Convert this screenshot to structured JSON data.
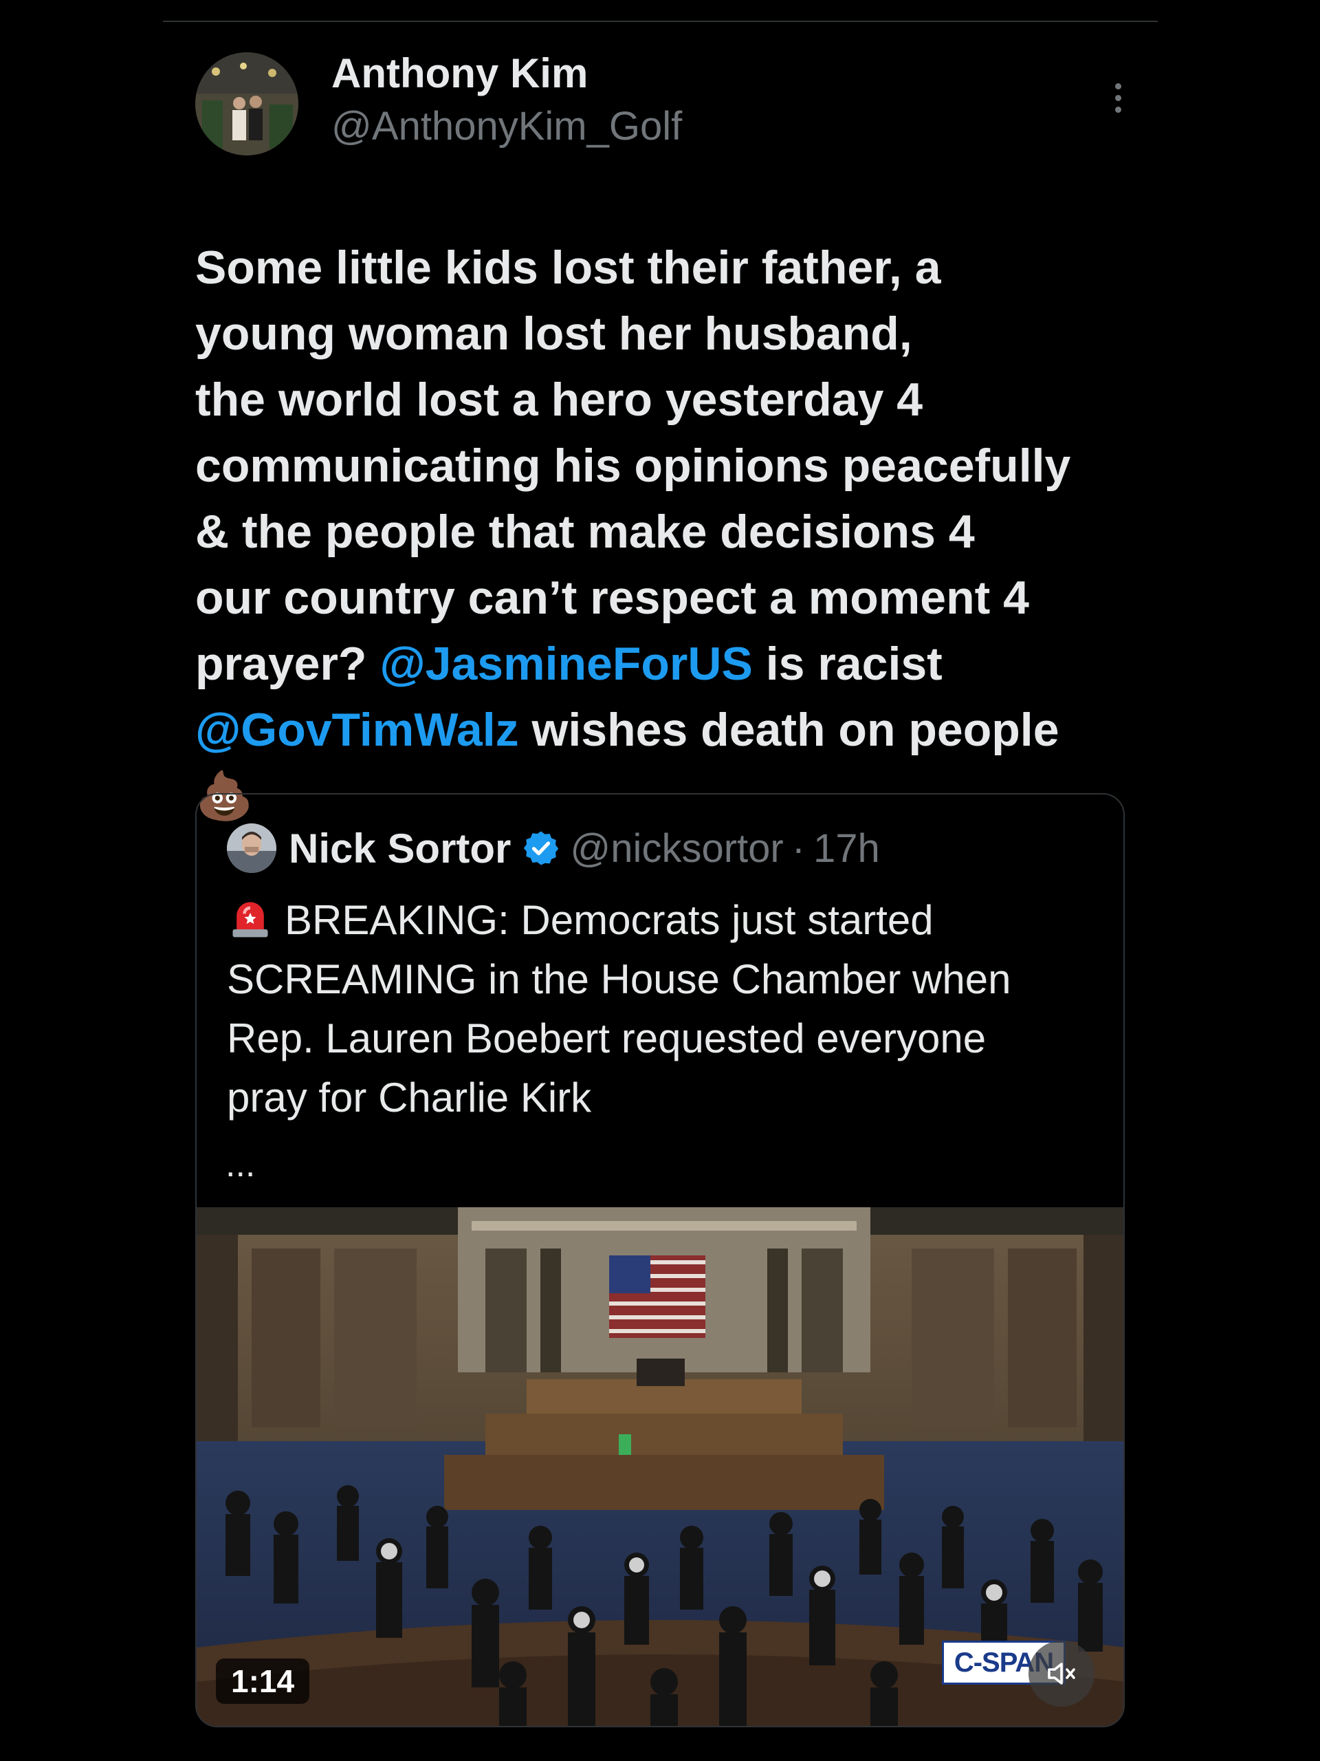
{
  "post": {
    "author_name": "Anthony Kim",
    "author_handle": "@AnthonyKim_Golf",
    "text_lines": [
      [
        {
          "t": "Some little kids lost their father, a",
          "m": false
        }
      ],
      [
        {
          "t": "young woman lost her husband,",
          "m": false
        }
      ],
      [
        {
          "t": "the world lost a hero yesterday 4",
          "m": false
        }
      ],
      [
        {
          "t": "communicating his opinions peacefully",
          "m": false
        }
      ],
      [
        {
          "t": "& the people that make decisions 4",
          "m": false
        }
      ],
      [
        {
          "t": "our country can’t respect a moment 4",
          "m": false
        }
      ],
      [
        {
          "t": "prayer? ",
          "m": false
        },
        {
          "t": "@JasmineForUS",
          "m": true
        },
        {
          "t": " is racist",
          "m": false
        }
      ],
      [
        {
          "t": "@GovTimWalz",
          "m": true
        },
        {
          "t": " wishes death on people",
          "m": false
        }
      ],
      [
        {
          "t": "💩",
          "m": false
        }
      ]
    ],
    "more_icon": "more-horizontal-icon"
  },
  "quote": {
    "author_name": "Nick Sortor",
    "verified_icon": "verified-badge-icon",
    "author_handle": "@nicksortor",
    "separator": "·",
    "time": "17h",
    "siren_icon": "rotating-light-icon",
    "body_lines": [
      "BREAKING: Democrats just started",
      "SCREAMING in the House Chamber when",
      "Rep. Lauren Boebert requested everyone",
      "pray for Charlie Kirk"
    ],
    "truncation": "...",
    "media": {
      "duration": "1:14",
      "watermark": "C-SPAN",
      "mute_icon": "volume-muted-icon"
    }
  },
  "colors": {
    "background": "#000000",
    "text": "#e7e9ea",
    "secondary": "#71767b",
    "mention": "#1d9bf0",
    "border": "#2f3336"
  }
}
